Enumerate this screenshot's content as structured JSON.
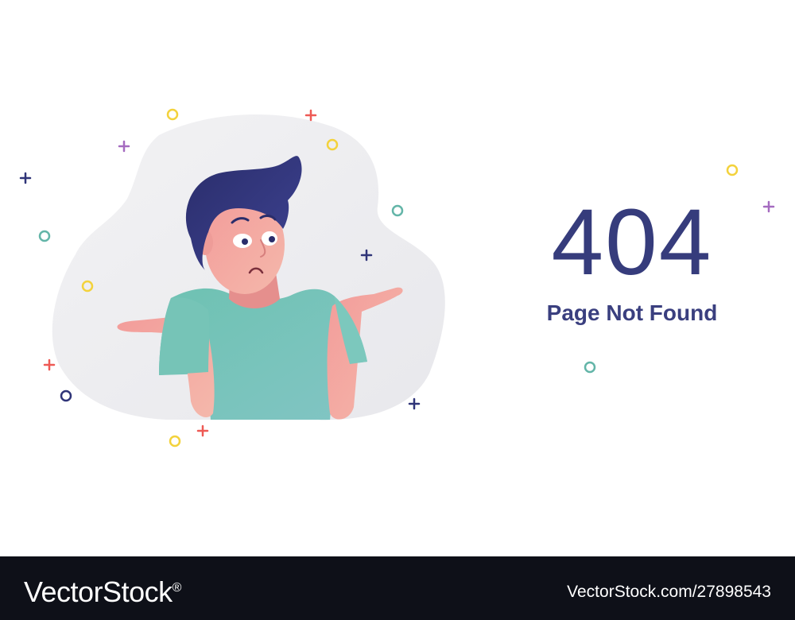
{
  "error": {
    "code": "404",
    "message": "Page Not Found"
  },
  "footer": {
    "logo": "VectorStock",
    "logo_mark": "®",
    "image_id": "VectorStock.com/27898543"
  },
  "colors": {
    "title": "#363c7c",
    "shirt": "#6fc0b1",
    "hair": "#2e3170",
    "skin": "#f0a8a3",
    "blob": "#ededf0",
    "footer_bg": "#0e1018",
    "confetti": [
      "#f3d23c",
      "#ee5a55",
      "#a56bc0",
      "#2f3478",
      "#63b5a8"
    ]
  },
  "icons": [
    "plus-icon",
    "ring-icon",
    "shrugging-man-illustration"
  ]
}
